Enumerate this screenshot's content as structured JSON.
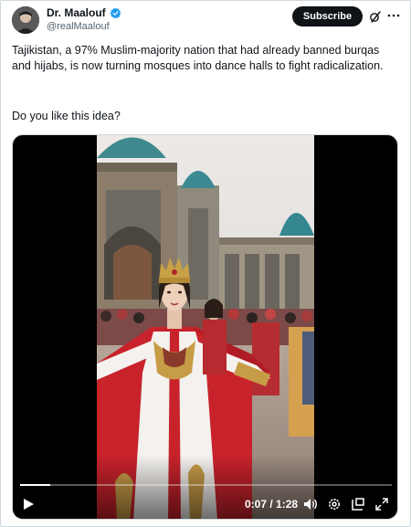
{
  "author": {
    "name": "Dr. Maalouf",
    "handle": "@realMaalouf",
    "avatar_icon": "avatar-portrait",
    "verified_color": "#1d9bf0"
  },
  "actions": {
    "subscribe_label": "Subscribe",
    "grok_icon": "grok-slash-icon",
    "more_icon": "more-dots-icon"
  },
  "tweet": {
    "text": "Tajikistan, a 97% Muslim-majority nation that had already banned burqas and hijabs, is now turning mosques into dance halls to fight radicalization.",
    "question": "Do you like this idea?"
  },
  "video": {
    "time": "0:07 / 1:28",
    "progress": 0.08,
    "controls": [
      "play-icon",
      "volume-icon",
      "settings-icon",
      "pip-icon",
      "fullscreen-icon"
    ]
  }
}
